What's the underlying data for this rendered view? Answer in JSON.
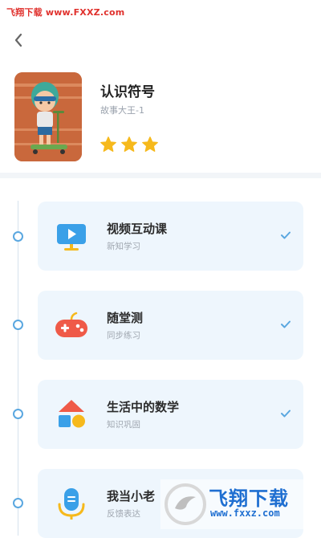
{
  "watermark_top": "飞翔下载 www.FXXZ.com",
  "header": {
    "title": "认识符号",
    "subtitle": "故事大王-1",
    "stars": 3
  },
  "tasks": [
    {
      "title": "视频互动课",
      "subtitle": "新知学习",
      "icon": "video-screen-icon",
      "completed": true
    },
    {
      "title": "随堂测",
      "subtitle": "同步练习",
      "icon": "gamepad-icon",
      "completed": true
    },
    {
      "title": "生活中的数学",
      "subtitle": "知识巩固",
      "icon": "shapes-house-icon",
      "completed": true
    },
    {
      "title": "我当小老",
      "subtitle": "反馈表达",
      "icon": "microphone-icon",
      "completed": false
    }
  ],
  "watermark_bottom": {
    "text": "飞翔下载",
    "url": "www.fxxz.com"
  },
  "colors": {
    "accent": "#5aa7e0",
    "card_bg": "#eef6fd",
    "star": "#f6b91c",
    "watermark": "#e0312d"
  }
}
